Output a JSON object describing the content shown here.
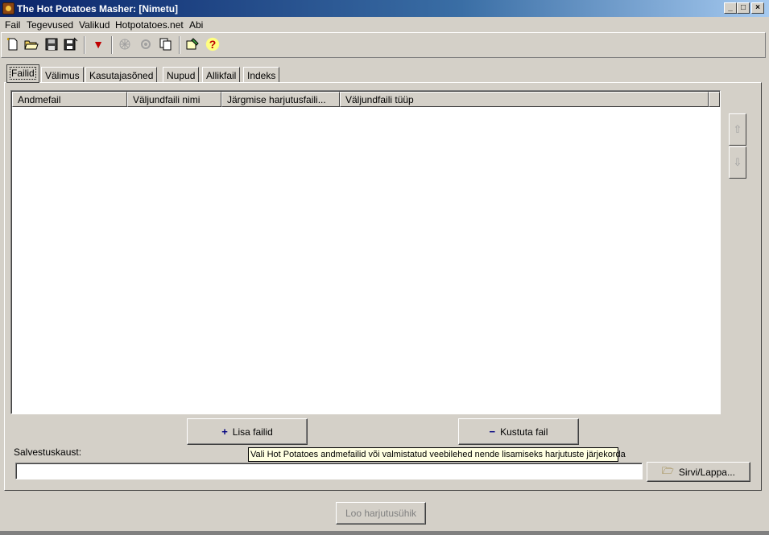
{
  "window": {
    "title": "The Hot Potatoes Masher: [Nimetu]",
    "min_glyph": "_",
    "max_glyph": "□",
    "close_glyph": "×"
  },
  "menu": [
    "Fail",
    "Tegevused",
    "Valikud",
    "Hotpotatoes.net",
    "Abi"
  ],
  "toolbar": {
    "icons": [
      "new-file-icon",
      "open-folder-icon",
      "save-icon",
      "save-as-icon",
      "down-arrow-icon",
      "web-icon",
      "settings-gear-icon",
      "copy-icon",
      "tools-icon",
      "help-icon"
    ],
    "help_glyph": "?",
    "down_glyph": "▼"
  },
  "tabs": [
    "Failid",
    "Välimus",
    "Kasutajasõned",
    "Nupud",
    "Allikfail",
    "Indeks"
  ],
  "active_tab": "Failid",
  "table": {
    "columns": [
      "Andmefail",
      "Väljundfaili nimi",
      "Järgmise harjutusfaili...",
      "Väljundfaili tüüp"
    ],
    "rows": []
  },
  "side_buttons": {
    "up_glyph": "⇧",
    "down_glyph": "⇩"
  },
  "buttons": {
    "add_files": "Lisa failid",
    "add_glyph": "+",
    "delete_file": "Kustuta fail",
    "delete_glyph": "−",
    "browse": "Sirvi/Lappa...",
    "browse_glyph": "🗁",
    "build": "Loo harjutusühik"
  },
  "save_folder": {
    "label": "Salvestuskaust:",
    "value": ""
  },
  "tooltip": "Vali Hot Potatoes andmefailid või valmistatud veebilehed nende lisamiseks harjutuste järjekorda"
}
